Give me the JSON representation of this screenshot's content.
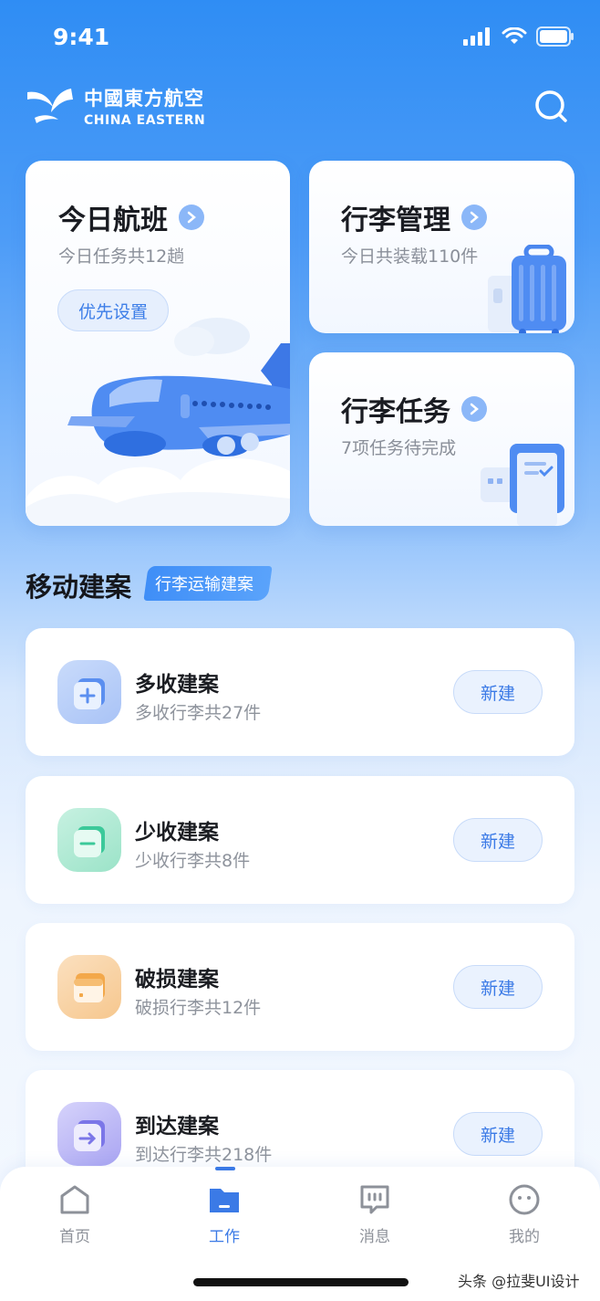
{
  "status": {
    "time": "9:41"
  },
  "brand": {
    "name_cn": "中國東方航空",
    "name_en": "CHINA EASTERN"
  },
  "cards": {
    "flights": {
      "title": "今日航班",
      "subtitle": "今日任务共12趟",
      "button": "优先设置"
    },
    "baggage": {
      "title": "行李管理",
      "subtitle": "今日共装载110件"
    },
    "tasks": {
      "title": "行李任务",
      "subtitle": "7项任务待完成"
    }
  },
  "section": {
    "title": "移动建案",
    "tag": "行李运输建案"
  },
  "rows": [
    {
      "title": "多收建案",
      "subtitle": "多收行李共27件",
      "button": "新建",
      "icon": "plus-icon",
      "color": "#5b8ff0"
    },
    {
      "title": "少收建案",
      "subtitle": "少收行李共8件",
      "button": "新建",
      "icon": "minus-icon",
      "color": "#3cc99a"
    },
    {
      "title": "破损建案",
      "subtitle": "破损行李共12件",
      "button": "新建",
      "icon": "card-icon",
      "color": "#f3a84a"
    },
    {
      "title": "到达建案",
      "subtitle": "到达行李共218件",
      "button": "新建",
      "icon": "arrow-icon",
      "color": "#7b76e8"
    }
  ],
  "tabs": [
    {
      "label": "首页",
      "icon": "home-icon"
    },
    {
      "label": "工作",
      "icon": "folder-icon",
      "active": true
    },
    {
      "label": "消息",
      "icon": "message-icon"
    },
    {
      "label": "我的",
      "icon": "profile-icon"
    }
  ],
  "watermark": "头条 @拉斐UI设计",
  "colors": {
    "primary": "#3b7ae6",
    "bg_top": "#2f8df4"
  }
}
